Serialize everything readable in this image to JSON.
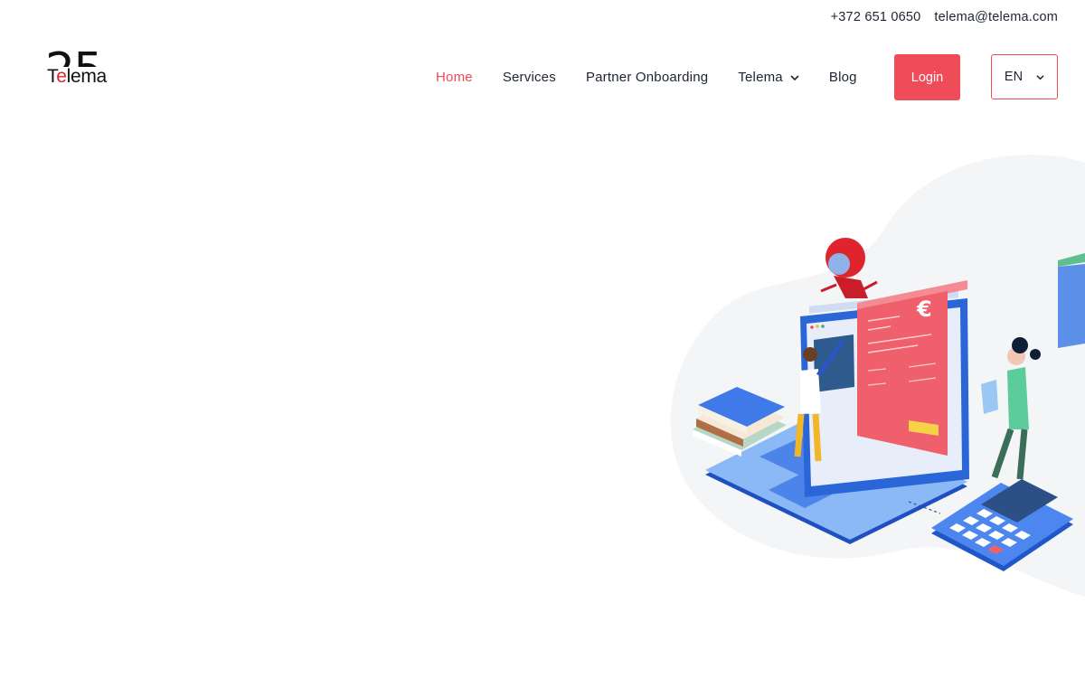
{
  "topbar": {
    "phone": "+372 651 0650",
    "email": "telema@telema.com"
  },
  "logo": {
    "number": "25",
    "word_start": "T",
    "word_accent": "e",
    "word_end": "lema"
  },
  "nav": {
    "items": [
      {
        "label": "Home",
        "active": true
      },
      {
        "label": "Services"
      },
      {
        "label": "Partner Onboarding"
      },
      {
        "label": "Telema",
        "has_dropdown": true
      },
      {
        "label": "Blog"
      }
    ],
    "login_label": "Login",
    "language": "EN"
  },
  "illustration": {
    "currency_symbol": "€"
  },
  "colors": {
    "accent": "#f04b58",
    "text": "#1d2433",
    "laptop_blue": "#2f6fe0"
  }
}
